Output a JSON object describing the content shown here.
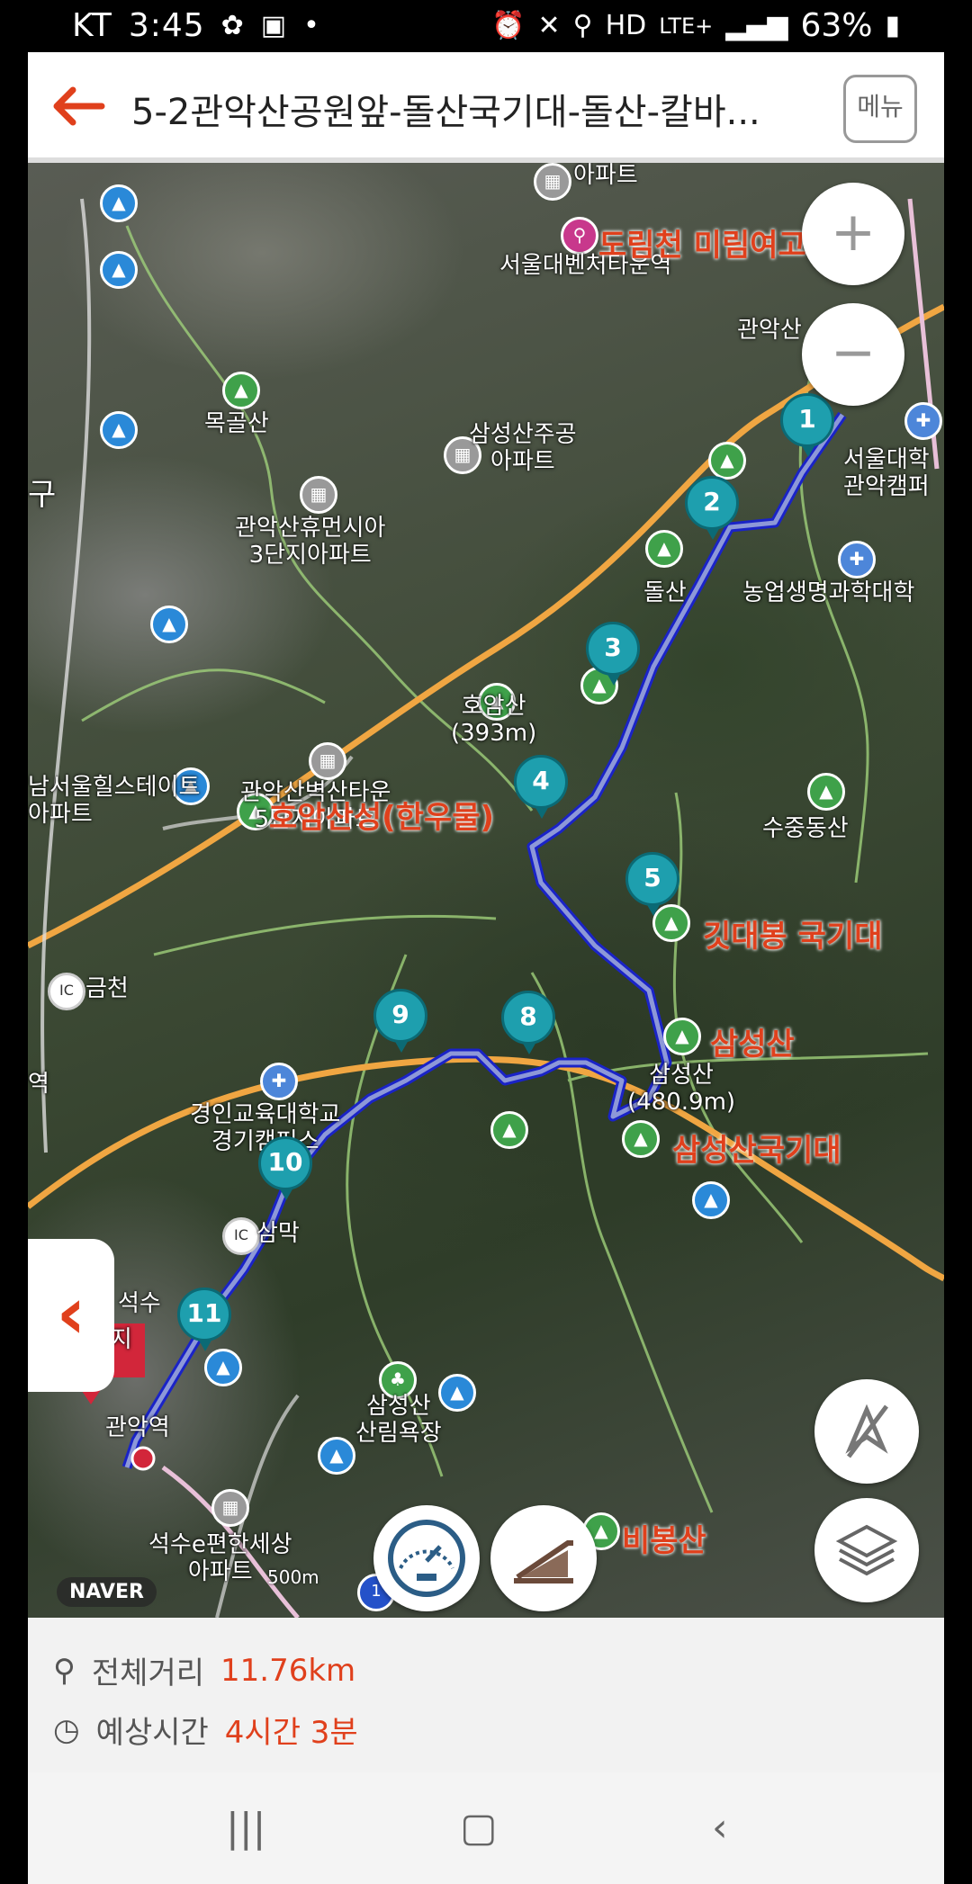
{
  "status": {
    "carrier": "KT",
    "time": "3:45",
    "battery": "63%",
    "network": "LTE+"
  },
  "header": {
    "title": "5-2관악산공원앞-돌산국기대-돌산-칼바...",
    "menu_label": "메뉴"
  },
  "map": {
    "labels_place": [
      {
        "id": "apt-top",
        "text": "아파트"
      },
      {
        "id": "seoul-bike",
        "text": "서울대벤처타운역"
      },
      {
        "id": "gwanak-stn",
        "text": "관악산"
      },
      {
        "id": "mokgol",
        "text": "목골산"
      },
      {
        "id": "samsung-apt",
        "text": "삼성산주공\n아파트"
      },
      {
        "id": "snu",
        "text": "서울대학\n관악캠퍼"
      },
      {
        "id": "humansia",
        "text": "관악산휴먼시아\n3단지아파트"
      },
      {
        "id": "dolsan",
        "text": "돌산"
      },
      {
        "id": "agri",
        "text": "농업생명과학대학"
      },
      {
        "id": "hoamsan",
        "text": "호암산\n(393m)"
      },
      {
        "id": "namseoul",
        "text": "남서울힐스테이트\n아파트"
      },
      {
        "id": "byeoksan",
        "text": "관악산벽산타운\n5단지아파트"
      },
      {
        "id": "sujungdong",
        "text": "수중동산"
      },
      {
        "id": "geumcheon",
        "text": "금천"
      },
      {
        "id": "samsungsan-peak",
        "text": "삼성산\n(480.9m)"
      },
      {
        "id": "gyeongin",
        "text": "경인교육대학교\n경기캠퍼스"
      },
      {
        "id": "station-left",
        "text": "역"
      },
      {
        "id": "sammak",
        "text": "삼막"
      },
      {
        "id": "seoksu",
        "text": "석수"
      },
      {
        "id": "gwanak-yeok",
        "text": "관악역"
      },
      {
        "id": "samsung-forest",
        "text": "삼성산\n산림욕장"
      },
      {
        "id": "seoksu-apt",
        "text": "석수e편한세상\n아파트"
      },
      {
        "id": "gu",
        "text": "구"
      }
    ],
    "labels_highlight": [
      {
        "id": "dorimcheon",
        "text": "도림천 미림여고"
      },
      {
        "id": "hoamsanseong",
        "text": "호암산성(한우물)"
      },
      {
        "id": "gitdaebong",
        "text": "깃대봉 국기대"
      },
      {
        "id": "samsungsan",
        "text": "삼성산"
      },
      {
        "id": "samsungsan-flag",
        "text": "삼성산국기대"
      },
      {
        "id": "bibongsan",
        "text": "비봉산"
      }
    ],
    "waypoints": [
      "1",
      "2",
      "3",
      "4",
      "5",
      "8",
      "9",
      "10",
      "11"
    ],
    "arrival_label": "도착지",
    "ic_label": "IC",
    "highway_number": "1",
    "provider": "NAVER",
    "scale_label": "500m"
  },
  "summary": {
    "distance_label": "전체거리",
    "distance_value": "11.76km",
    "time_label": "예상시간",
    "time_value": "4시간 3분"
  }
}
